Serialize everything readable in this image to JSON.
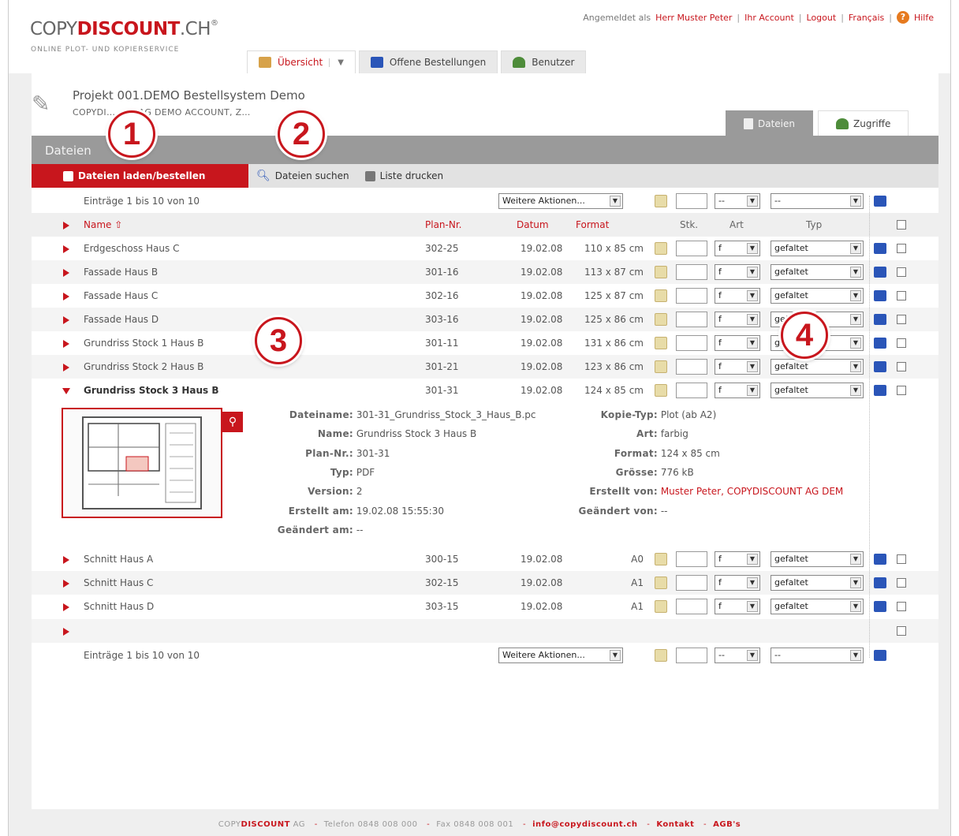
{
  "header": {
    "logo_main": "COPY",
    "logo_brand": "DISCOUNT",
    "logo_suffix": ".CH",
    "logo_mark": "®",
    "logo_sub": "ONLINE PLOT- UND KOPIERSERVICE",
    "logged_in_label": "Angemeldet als",
    "user_name": "Herr Muster Peter",
    "account_link": "Ihr Account",
    "logout_link": "Logout",
    "lang_link": "Français",
    "help_link": "Hilfe"
  },
  "main_tabs": [
    {
      "label": "Übersicht",
      "icon": "house-icon"
    },
    {
      "label": "Offene Bestellungen",
      "icon": "cart-icon"
    },
    {
      "label": "Benutzer",
      "icon": "users-icon"
    }
  ],
  "project": {
    "title": "Projekt 001.DEMO Bestellsystem Demo",
    "subtitle": "COPYDI… …IT AG DEMO ACCOUNT, Z…"
  },
  "sub_tabs": [
    {
      "label": "Dateien"
    },
    {
      "label": "Zugriffe"
    }
  ],
  "section": {
    "title": "Dateien",
    "action_load": "Dateien laden/bestellen",
    "action_search": "Dateien suchen",
    "action_print": "Liste drucken"
  },
  "toolbar": {
    "entries_top": "Einträge 1 bis 10 von 10",
    "entries_bottom": "Einträge 1 bis 10 von 10",
    "more_actions": "Weitere Aktionen...",
    "art_default": "--",
    "typ_default": "--"
  },
  "table": {
    "headers": {
      "name": "Name",
      "plan": "Plan-Nr.",
      "datum": "Datum",
      "format": "Format",
      "stk": "Stk.",
      "art": "Art",
      "typ": "Typ"
    },
    "rows": [
      {
        "name": "Erdgeschoss Haus C",
        "plan": "302-25",
        "datum": "19.02.08",
        "format": "110 x 85 cm",
        "art": "f",
        "typ": "gefaltet"
      },
      {
        "name": "Fassade Haus B",
        "plan": "301-16",
        "datum": "19.02.08",
        "format": "113 x 87 cm",
        "art": "f",
        "typ": "gefaltet"
      },
      {
        "name": "Fassade Haus C",
        "plan": "302-16",
        "datum": "19.02.08",
        "format": "125 x 87 cm",
        "art": "f",
        "typ": "gefaltet"
      },
      {
        "name": "Fassade Haus D",
        "plan": "303-16",
        "datum": "19.02.08",
        "format": "125 x 86 cm",
        "art": "f",
        "typ": "gefaltet"
      },
      {
        "name": "Grundriss Stock 1 Haus B",
        "plan": "301-11",
        "datum": "19.02.08",
        "format": "131 x 86 cm",
        "art": "f",
        "typ": "gefaltet"
      },
      {
        "name": "Grundriss Stock 2 Haus B",
        "plan": "301-21",
        "datum": "19.02.08",
        "format": "123 x 86 cm",
        "art": "f",
        "typ": "gefaltet"
      },
      {
        "name": "Grundriss Stock 3 Haus B",
        "plan": "301-31",
        "datum": "19.02.08",
        "format": "124 x 85 cm",
        "art": "f",
        "typ": "gefaltet"
      },
      {
        "name": "Schnitt Haus A",
        "plan": "300-15",
        "datum": "19.02.08",
        "format": "A0",
        "art": "f",
        "typ": "gefaltet"
      },
      {
        "name": "Schnitt Haus C",
        "plan": "302-15",
        "datum": "19.02.08",
        "format": "A1",
        "art": "f",
        "typ": "gefaltet"
      },
      {
        "name": "Schnitt Haus D",
        "plan": "303-15",
        "datum": "19.02.08",
        "format": "A1",
        "art": "f",
        "typ": "gefaltet"
      }
    ]
  },
  "detail": {
    "left": [
      {
        "k": "Dateiname:",
        "v": "301-31_Grundriss_Stock_3_Haus_B.pc"
      },
      {
        "k": "Name:",
        "v": "Grundriss Stock 3 Haus B"
      },
      {
        "k": "Plan-Nr.:",
        "v": "301-31"
      },
      {
        "k": "Typ:",
        "v": "PDF"
      },
      {
        "k": "Version:",
        "v": "2"
      },
      {
        "k": "Erstellt am:",
        "v": "19.02.08 15:55:30"
      },
      {
        "k": "Geändert am:",
        "v": "--"
      }
    ],
    "right": [
      {
        "k": "Kopie-Typ:",
        "v": "Plot (ab A2)"
      },
      {
        "k": "Art:",
        "v": "farbig"
      },
      {
        "k": "Format:",
        "v": "124 x 85 cm"
      },
      {
        "k": "Grösse:",
        "v": "776 kB"
      },
      {
        "k": "Erstellt von:",
        "v": "Muster Peter, COPYDISCOUNT AG DEM"
      },
      {
        "k": "Geändert von:",
        "v": "--"
      }
    ]
  },
  "badges": [
    "1",
    "2",
    "3",
    "4"
  ],
  "footer": {
    "company_a": "COPY",
    "company_b": "DISCOUNT",
    "company_c": "AG",
    "phone": "Telefon 0848 008 000",
    "fax": "Fax 0848 008 001",
    "email": "info@copydiscount.ch",
    "contact": "Kontakt",
    "agb": "AGB's"
  },
  "colors": {
    "brand_red": "#c8161d",
    "section_grey": "#9a9a9a",
    "cart_blue": "#2a55b8"
  }
}
